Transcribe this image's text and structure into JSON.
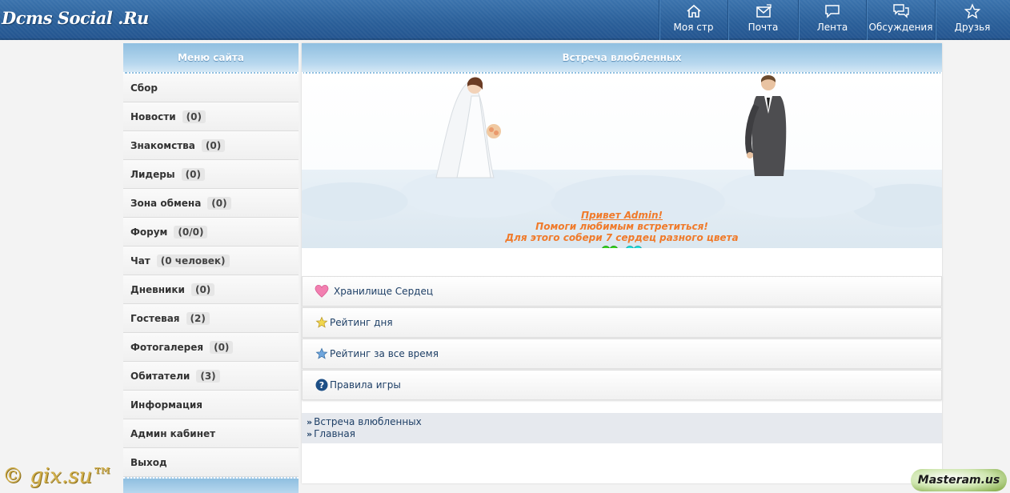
{
  "site": {
    "logo": "Dcms Social .Ru"
  },
  "nav": [
    {
      "label": "Моя стр",
      "icon": "home-icon"
    },
    {
      "label": "Почта",
      "icon": "mail-icon"
    },
    {
      "label": "Лента",
      "icon": "feed-icon"
    },
    {
      "label": "Обсуждения",
      "icon": "discussions-icon"
    },
    {
      "label": "Друзья",
      "icon": "star-icon"
    }
  ],
  "sidebar": {
    "title": "Меню сайта",
    "items": [
      {
        "label": "Сбор",
        "count": ""
      },
      {
        "label": "Новости",
        "count": "(0)"
      },
      {
        "label": "Знакомства",
        "count": "(0)"
      },
      {
        "label": "Лидеры",
        "count": "(0)"
      },
      {
        "label": "Зона обмена",
        "count": "(0)"
      },
      {
        "label": "Форум",
        "count": "(0/0)"
      },
      {
        "label": "Чат",
        "count": "(0 человек)"
      },
      {
        "label": "Дневники",
        "count": "(0)"
      },
      {
        "label": "Гостевая",
        "count": "(2)"
      },
      {
        "label": "Фотогалерея",
        "count": "(0)"
      },
      {
        "label": "Обитатели",
        "count": "(3)"
      },
      {
        "label": "Информация",
        "count": ""
      },
      {
        "label": "Админ кабинет",
        "count": ""
      },
      {
        "label": "Выход",
        "count": ""
      }
    ]
  },
  "main": {
    "title": "Встреча влюбленных",
    "greeting": "Привет Admin!",
    "line2": "Помоги любимым встретиться!",
    "line3": "Для этого собери 7 сердец разного цвета",
    "hearts_colors": [
      "#35d61f",
      "#22e2e0"
    ],
    "menu": [
      {
        "label": "Хранилище Сердец",
        "icon": "pink-heart-icon"
      },
      {
        "label": "Рейтинг дня",
        "icon": "gold-star-icon"
      },
      {
        "label": "Рейтинг за все время",
        "icon": "blue-star-icon"
      },
      {
        "label": "Правила игры",
        "icon": "help-icon"
      }
    ],
    "breadcrumbs": [
      "Встреча влюбленных",
      "Главная"
    ]
  },
  "watermark": "© gix.su™",
  "badge": "Masteram.us"
}
